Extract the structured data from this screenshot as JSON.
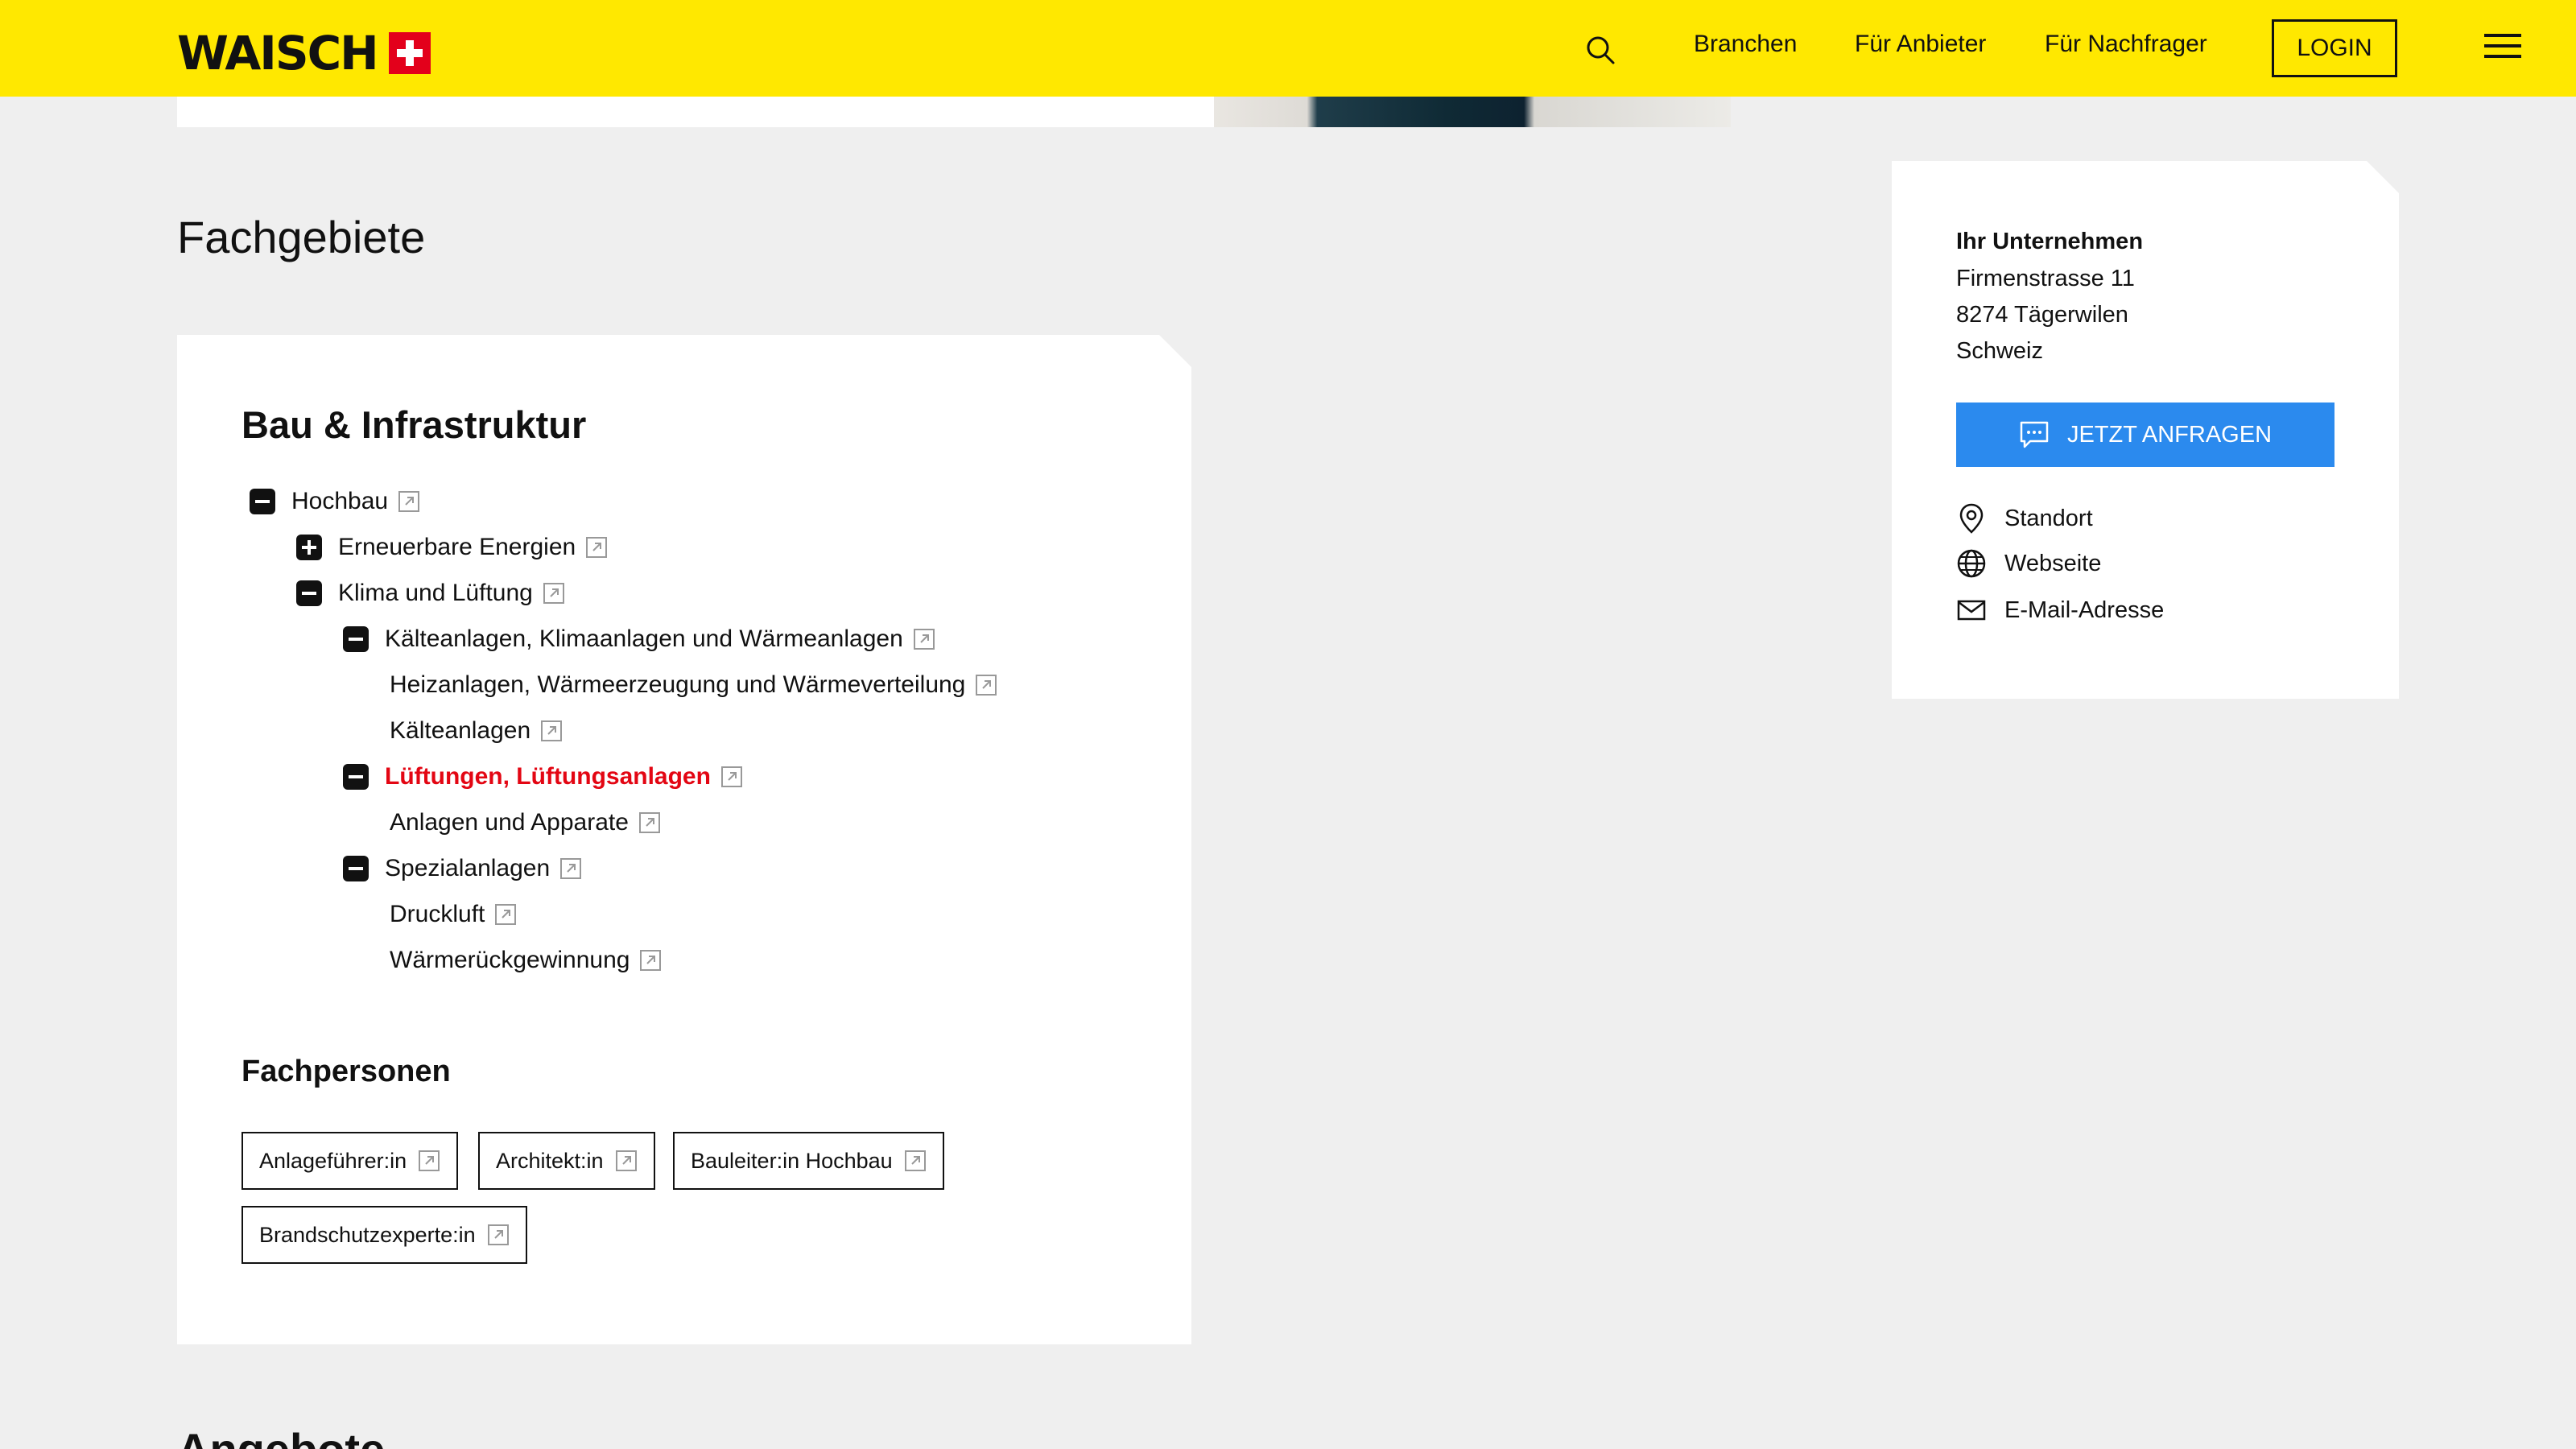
{
  "header": {
    "logo_text": "WAISCH",
    "nav": [
      "Branchen",
      "Für Anbieter",
      "Für Nachfrager"
    ],
    "login_label": "LOGIN"
  },
  "section_title": "Fachgebiete",
  "main": {
    "heading": "Bau & Infrastruktur",
    "tree": [
      {
        "label": "Hochbau",
        "toggle": "minus"
      },
      {
        "label": "Erneuerbare Energien",
        "toggle": "plus"
      },
      {
        "label": "Klima und Lüftung",
        "toggle": "minus"
      },
      {
        "label": "Kälteanlagen, Klimaanlagen und Wärmeanlagen",
        "toggle": "minus"
      },
      {
        "label": "Heizanlagen, Wärmeerzeugung und Wärmeverteilung",
        "toggle": "none"
      },
      {
        "label": "Kälteanlagen",
        "toggle": "none"
      },
      {
        "label": "Lüftungen, Lüftungsanlagen",
        "toggle": "minus",
        "active": true
      },
      {
        "label": "Anlagen und Apparate",
        "toggle": "none"
      },
      {
        "label": "Spezialanlagen",
        "toggle": "minus"
      },
      {
        "label": "Druckluft",
        "toggle": "none"
      },
      {
        "label": "Wärmerückgewinnung",
        "toggle": "none"
      }
    ],
    "fachpersonen_heading": "Fachpersonen",
    "tags": [
      "Anlageführer:in",
      "Architekt:in",
      "Bauleiter:in Hochbau",
      "Brandschutzexperte:in"
    ]
  },
  "next_section_title": "Angebote",
  "sidebar": {
    "company": "Ihr Unternehmen",
    "address": [
      "Firmenstrasse 11",
      "8274 Tägerwilen",
      "Schweiz"
    ],
    "cta_label": "JETZT ANFRAGEN",
    "contacts": [
      "Standort",
      "Webseite",
      "E-Mail-Adresse"
    ]
  },
  "colors": {
    "header_bg": "#ffe800",
    "accent_blue": "#2b8aee",
    "active_red": "#e30613",
    "swiss_red": "#e3001b"
  }
}
